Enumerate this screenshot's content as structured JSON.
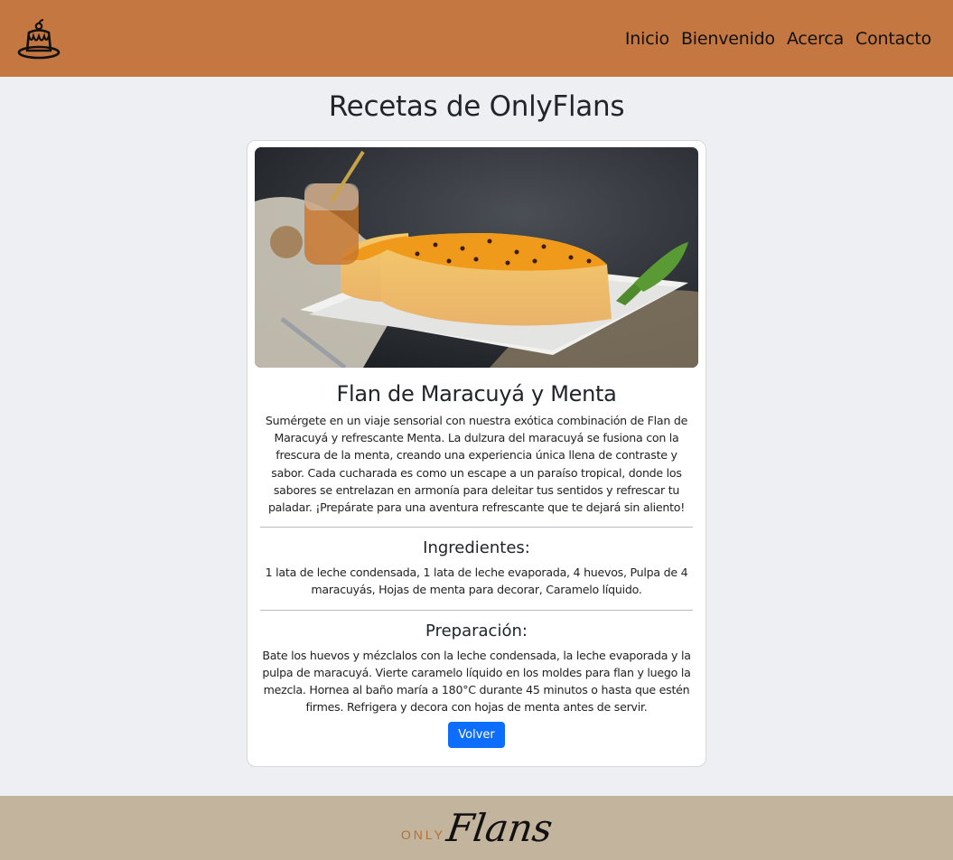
{
  "nav": {
    "logo_icon": "flan-dessert-icon",
    "links": [
      "Inicio",
      "Bienvenido",
      "Acerca",
      "Contacto"
    ]
  },
  "page": {
    "title": "Recetas de OnlyFlans"
  },
  "recipe": {
    "image": "passion-fruit-flan-photo",
    "title": "Flan de Maracuyá y Menta",
    "description": "Sumérgete en un viaje sensorial con nuestra exótica combinación de Flan de Maracuyá y refrescante Menta. La dulzura del maracuyá se fusiona con la frescura de la menta, creando una experiencia única llena de contraste y sabor. Cada cucharada es como un escape a un paraíso tropical, donde los sabores se entrelazan en armonía para deleitar tus sentidos y refrescar tu paladar. ¡Prepárate para una aventura refrescante que te dejará sin aliento!",
    "ingredients_title": "Ingredientes:",
    "ingredients": "1 lata de leche condensada, 1 lata de leche evaporada, 4 huevos, Pulpa de 4 maracuyás, Hojas de menta para decorar, Caramelo líquido.",
    "preparation_title": "Preparación:",
    "preparation": "Bate los huevos y mézclalos con la leche condensada, la leche evaporada y la pulpa de maracuyá. Vierte caramelo líquido en los moldes para flan y luego la mezcla. Hornea al baño maría a 180°C durante 45 minutos o hasta que estén firmes. Refrigera y decora con hojas de menta antes de servir.",
    "back_button": "Volver"
  },
  "footer": {
    "logo_small": "ONLY",
    "logo_large": "Flans"
  },
  "colors": {
    "navbar": "#c47741",
    "background": "#eeeff3",
    "footer": "#c2b49d",
    "button": "#0d6efd"
  }
}
